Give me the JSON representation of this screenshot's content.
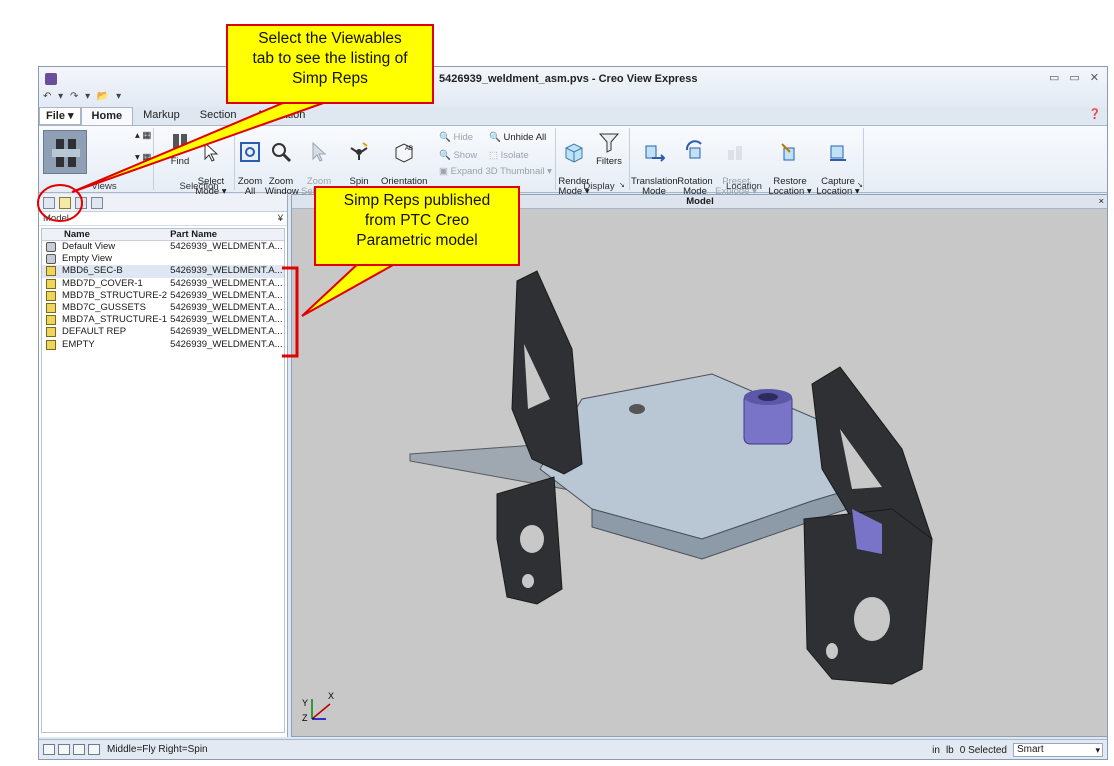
{
  "window": {
    "title": "5426939_weldment_asm.pvs - Creo View Express",
    "quick_access": "↶ ▾ ↷ ▾ 📂 ▾",
    "controls": [
      "▭",
      "▭",
      "✕"
    ]
  },
  "ribbon_tabs": [
    "File ▾",
    "Home",
    "Markup",
    "Section",
    "Animation"
  ],
  "ribbon": {
    "buttons": {
      "find": "Find",
      "select_mode": "Select\nMode ▾",
      "zoom_all": "Zoom\nAll",
      "zoom_window": "Zoom\nWindow",
      "zoom_selected": "Zoom\nSelected",
      "spin_center": "Spin\nCenter ▾",
      "orientation": "Orientation\n▾",
      "hide": "Hide",
      "unhide_all": "Unhide All",
      "show": "Show",
      "isolate": "Isolate",
      "expand_thumbnail": "Expand 3D Thumbnail ▾",
      "render_mode": "Render\nMode ▾",
      "filters": "Filters",
      "translation_mode": "Translation\nMode",
      "rotation_mode": "Rotation\nMode",
      "preset_explode": "Preset\nExplode ▾",
      "restore_location": "Restore\nLocation ▾",
      "capture_location": "Capture\nLocation ▾"
    },
    "groups": {
      "views": "Views",
      "selection": "Selection",
      "display": "Display",
      "location": "Location"
    }
  },
  "left_panel": {
    "header": "Model",
    "columns": {
      "name": "Name",
      "part": "Part Name"
    },
    "rows": [
      {
        "name": "Default View",
        "part": "5426939_WELDMENT.A..."
      },
      {
        "name": "Empty View",
        "part": ""
      },
      {
        "name": "MBD6_SEC-B",
        "part": "5426939_WELDMENT.A..."
      },
      {
        "name": "MBD7D_COVER-1",
        "part": "5426939_WELDMENT.A..."
      },
      {
        "name": "MBD7B_STRUCTURE-2",
        "part": "5426939_WELDMENT.A..."
      },
      {
        "name": "MBD7C_GUSSETS",
        "part": "5426939_WELDMENT.A..."
      },
      {
        "name": "MBD7A_STRUCTURE-1",
        "part": "5426939_WELDMENT.A..."
      },
      {
        "name": "DEFAULT REP",
        "part": "5426939_WELDMENT.A..."
      },
      {
        "name": "EMPTY",
        "part": "5426939_WELDMENT.A..."
      }
    ]
  },
  "viewport": {
    "title": "Model",
    "close": "×",
    "triad": {
      "x": "X",
      "y": "Y",
      "z": "Z"
    }
  },
  "status_bar": {
    "hint": "Middle=Fly  Right=Spin",
    "units_length": "in",
    "units_mass": "lb",
    "selected": "0 Selected",
    "mode": "Smart"
  },
  "callouts": {
    "viewables": [
      "Select the Viewables",
      "tab to see the listing of",
      "Simp Reps"
    ],
    "simp_reps": [
      "Simp Reps published",
      "from PTC Creo",
      "Parametric model"
    ]
  },
  "colors": {
    "callout_fill": "#ffff00",
    "callout_border": "#e00000",
    "viewport_bg": "#c8c8c8",
    "part_dark": "#2f3033",
    "part_light": "#b9c6d3",
    "part_purple": "#7a74c9"
  }
}
